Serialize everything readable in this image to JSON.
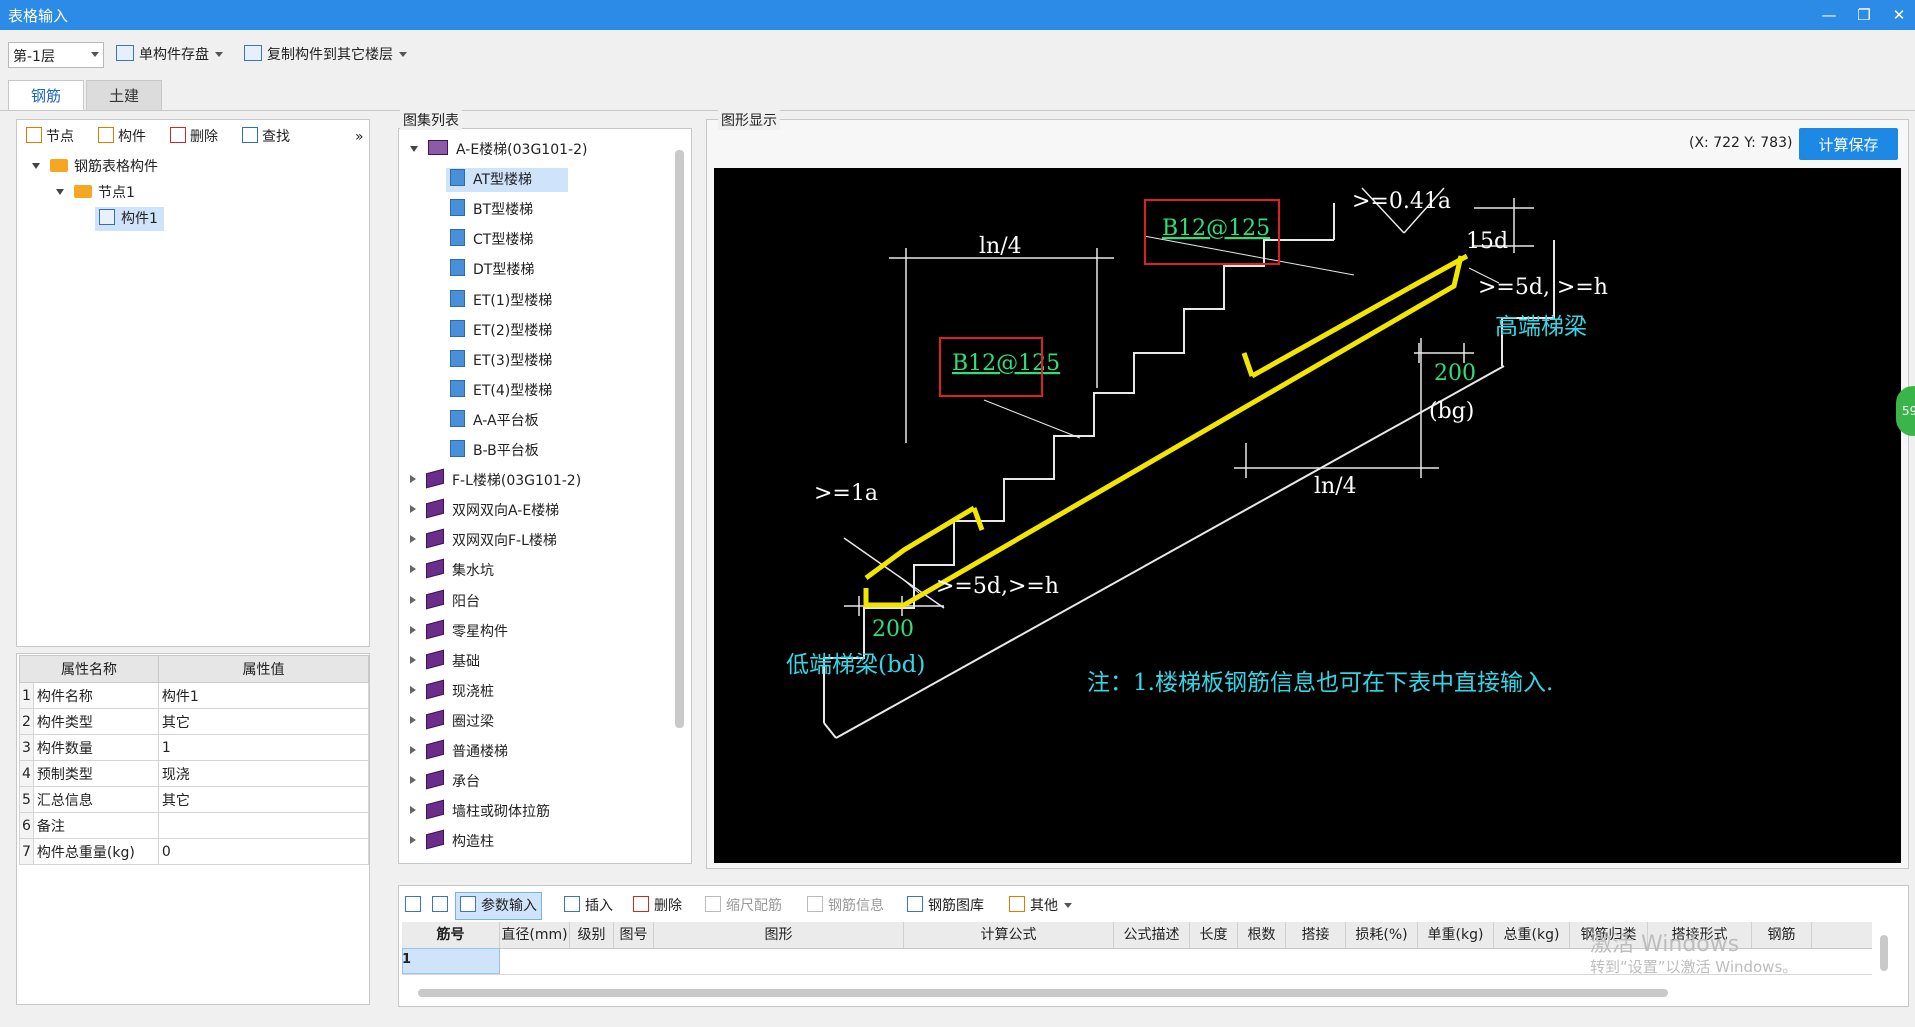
{
  "window": {
    "title": "表格输入"
  },
  "toolbar": {
    "floor_select": "第-1层",
    "save_single": "单构件存盘",
    "copy_to_floor": "复制构件到其它楼层"
  },
  "tabs": [
    "钢筋",
    "土建"
  ],
  "left_toolbar": {
    "node": "节点",
    "component": "构件",
    "delete": "删除",
    "find": "查找",
    "more": "»"
  },
  "tree": {
    "root": "钢筋表格构件",
    "node": "节点1",
    "component": "构件1"
  },
  "attributes": {
    "headers": [
      "属性名称",
      "属性值"
    ],
    "rows": [
      {
        "idx": "1",
        "name": "构件名称",
        "value": "构件1"
      },
      {
        "idx": "2",
        "name": "构件类型",
        "value": "其它"
      },
      {
        "idx": "3",
        "name": "构件数量",
        "value": "1"
      },
      {
        "idx": "4",
        "name": "预制类型",
        "value": "现浇"
      },
      {
        "idx": "5",
        "name": "汇总信息",
        "value": "其它"
      },
      {
        "idx": "6",
        "name": "备注",
        "value": ""
      },
      {
        "idx": "7",
        "name": "构件总重量(kg)",
        "value": "0"
      }
    ]
  },
  "atlas": {
    "label": "图集列表",
    "group": "A-E楼梯(03G101-2)",
    "children": [
      "AT型楼梯",
      "BT型楼梯",
      "CT型楼梯",
      "DT型楼梯",
      "ET(1)型楼梯",
      "ET(2)型楼梯",
      "ET(3)型楼梯",
      "ET(4)型楼梯",
      "A-A平台板",
      "B-B平台板"
    ],
    "others": [
      "F-L楼梯(03G101-2)",
      "双网双向A-E楼梯",
      "双网双向F-L楼梯",
      "集水坑",
      "阳台",
      "零星构件",
      "基础",
      "现浇桩",
      "圈过梁",
      "普通楼梯",
      "承台",
      "墙柱或砌体拉筋",
      "构造柱"
    ]
  },
  "graphic": {
    "label": "图形显示",
    "coords": "(X: 722 Y: 783)",
    "calc_save": "计算保存",
    "badge": "59"
  },
  "drawing": {
    "ln4_top": "ln/4",
    "ln4_bottom": "ln/4",
    "rebar_top": "B12@125",
    "rebar_mid": "B12@125",
    "anchor_top": ">=0.41a",
    "bend_top": "15d",
    "hook_right": ">=5d, >=h",
    "high_beam": "高端梯梁",
    "dim_200_right": "200",
    "bg": "(bg)",
    "anchor_left": ">=1a",
    "hook_left": ">=5d,>=h",
    "dim_200_left": "200",
    "low_beam": "低端梯梁(bd)",
    "note": "注：1.楼梯板钢筋信息也可在下表中直接输入."
  },
  "bottom_toolbar": {
    "param_input": "参数输入",
    "insert": "插入",
    "delete": "删除",
    "scale_rebar": "缩尺配筋",
    "rebar_info": "钢筋信息",
    "rebar_library": "钢筋图库",
    "other": "其他"
  },
  "grid": {
    "headers": [
      "筋号",
      "直径(mm)",
      "级别",
      "图号",
      "图形",
      "计算公式",
      "公式描述",
      "长度",
      "根数",
      "搭接",
      "损耗(%)",
      "单重(kg)",
      "总重(kg)",
      "钢筋归类",
      "搭接形式",
      "钢筋"
    ],
    "row_index": "1"
  },
  "watermark": {
    "line1": "激活 Windows",
    "line2": "转到“设置”以激活 Windows。"
  }
}
